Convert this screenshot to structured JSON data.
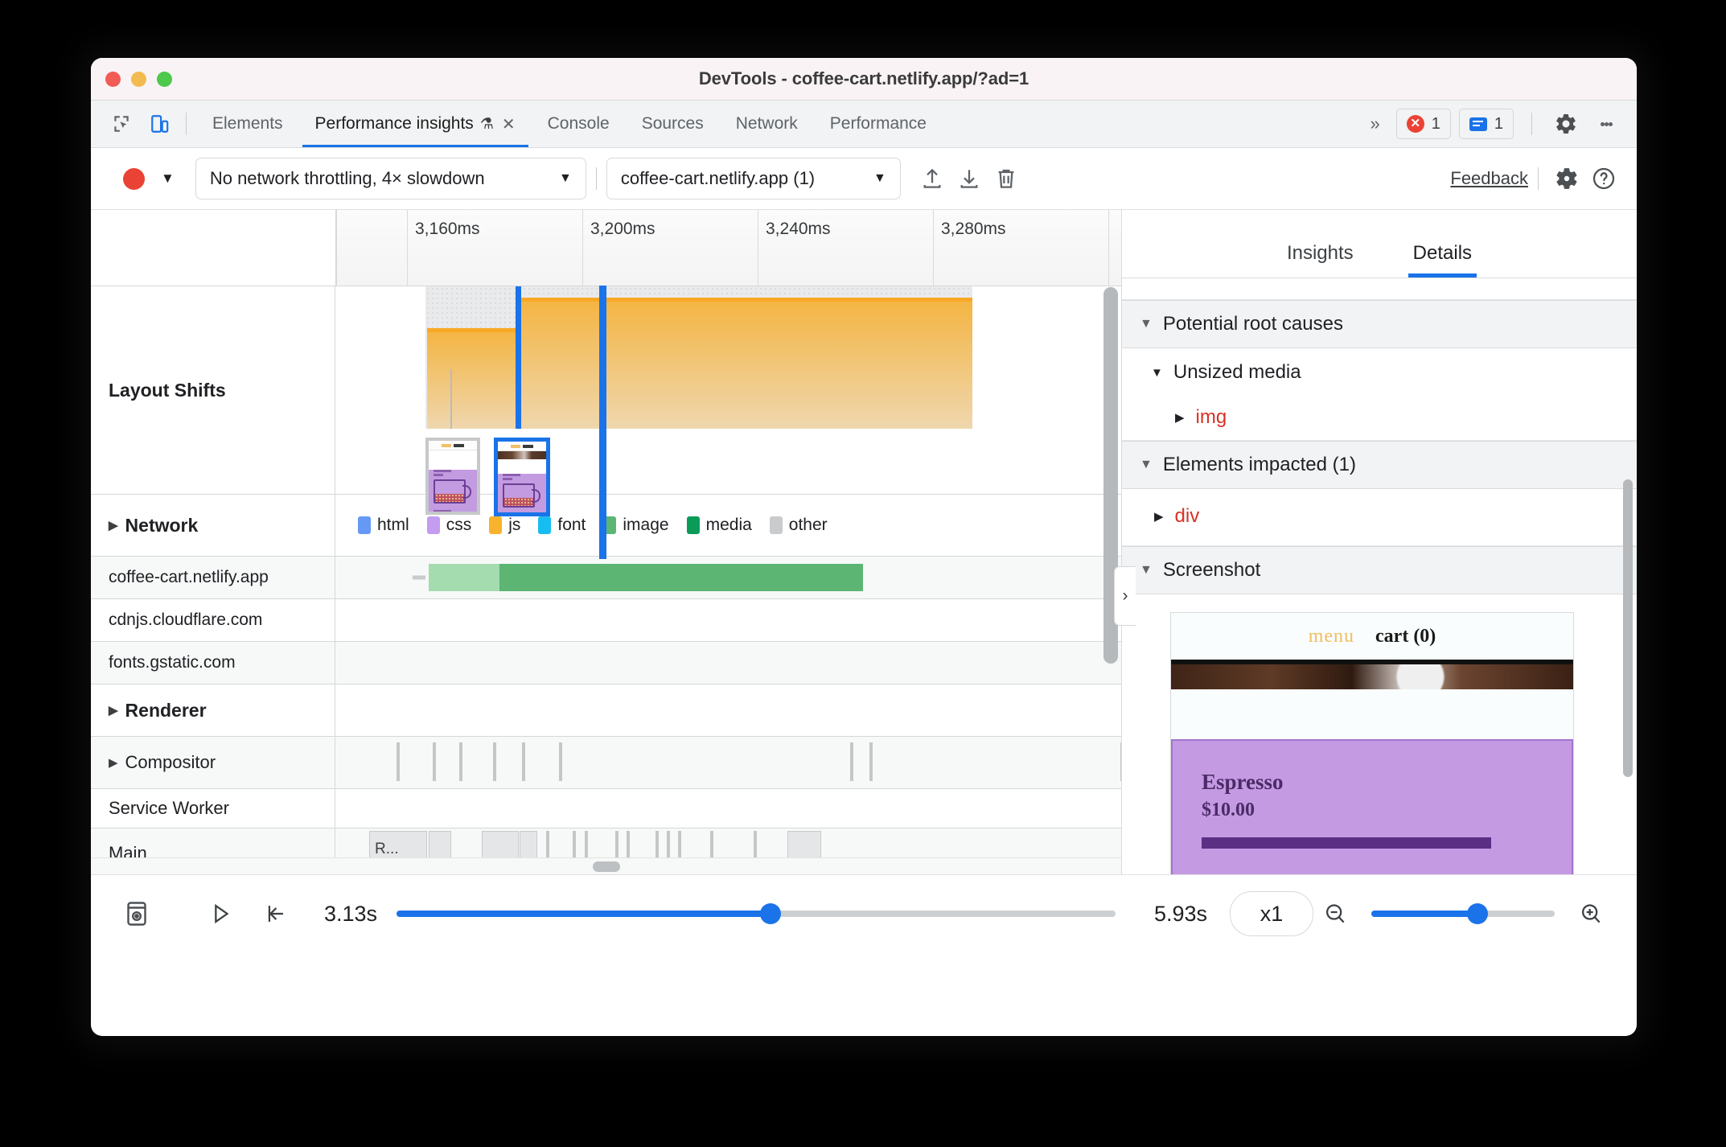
{
  "window": {
    "title": "DevTools - coffee-cart.netlify.app/?ad=1",
    "traffic_lights": [
      "close",
      "minimize",
      "zoom"
    ]
  },
  "tabstrip": {
    "left_icons": [
      "inspect-element-icon",
      "device-toolbar-icon"
    ],
    "tabs": [
      {
        "label": "Elements",
        "active": false
      },
      {
        "label": "Performance insights",
        "active": true,
        "flask": "⚗",
        "close": "✕"
      },
      {
        "label": "Console",
        "active": false
      },
      {
        "label": "Sources",
        "active": false
      },
      {
        "label": "Network",
        "active": false
      },
      {
        "label": "Performance",
        "active": false
      }
    ],
    "more_tabs": "»",
    "error_badge": "1",
    "message_badge": "1",
    "settings_icon": "gear-icon",
    "menu_icon": "kebab-menu-icon"
  },
  "toolbar": {
    "record_label": "record-button",
    "record_dropdown": "▼",
    "throttling": {
      "value": "No network throttling, 4× slowdown",
      "caret": "▼"
    },
    "origin": {
      "value": "coffee-cart.netlify.app (1)",
      "caret": "▼"
    },
    "upload_icon": "upload-icon",
    "download_icon": "download-icon",
    "delete_icon": "trash-icon",
    "feedback_label": "Feedback",
    "settings_icon": "settings-gear-icon",
    "help_icon": "help-icon"
  },
  "timeline": {
    "ruler_ticks": [
      "3,160ms",
      "3,200ms",
      "3,240ms",
      "3,280ms"
    ],
    "tracks": [
      {
        "name": "Layout Shifts",
        "bold": true,
        "expandable": false
      },
      {
        "name": "Network",
        "bold": true,
        "expandable": true,
        "arrow": "▶"
      },
      {
        "name": "coffee-cart.netlify.app",
        "bold": false,
        "expandable": false
      },
      {
        "name": "cdnjs.cloudflare.com",
        "bold": false,
        "expandable": false
      },
      {
        "name": "fonts.gstatic.com",
        "bold": false,
        "expandable": false
      },
      {
        "name": "Renderer",
        "bold": true,
        "expandable": true,
        "arrow": "▶"
      },
      {
        "name": "Compositor",
        "bold": false,
        "expandable": true,
        "arrow": "▶"
      },
      {
        "name": "Service Worker",
        "bold": false,
        "expandable": false
      },
      {
        "name": "Main",
        "bold": false,
        "expandable": false
      }
    ],
    "network_legend": [
      {
        "label": "html",
        "color": "#6699f5"
      },
      {
        "label": "css",
        "color": "#c49cf0"
      },
      {
        "label": "js",
        "color": "#f7b32c"
      },
      {
        "label": "font",
        "color": "#16bdf0"
      },
      {
        "label": "image",
        "color": "#5cb573"
      },
      {
        "label": "media",
        "color": "#0a9b59"
      },
      {
        "label": "other",
        "color": "#c9cbcd"
      }
    ],
    "main_event_label": "R...",
    "sidebar_toggle": "›"
  },
  "details": {
    "tabs": [
      {
        "label": "Insights",
        "active": false
      },
      {
        "label": "Details",
        "active": true
      }
    ],
    "sections": [
      {
        "title": "Potential root causes",
        "caret": "▼"
      },
      {
        "title": "Elements impacted (1)",
        "caret": "▼"
      },
      {
        "title": "Screenshot",
        "caret": "▼"
      }
    ],
    "root_cause_group": {
      "caret": "▼",
      "label": "Unsized media"
    },
    "root_cause_node": {
      "caret": "▶",
      "tag": "img"
    },
    "impacted_node": {
      "caret": "▶",
      "tag": "div"
    },
    "screenshot_preview": {
      "menu_label": "menu",
      "cart_label": "cart (0)",
      "product_name": "Espresso",
      "product_price": "$10.00"
    }
  },
  "bottombar": {
    "filmstrip_icon": "screenshot-toggle-icon",
    "play_icon": "▷",
    "jump_start_icon": "jump-to-start-icon",
    "time_start": "3.13s",
    "time_end": "5.93s",
    "speed": "x1",
    "zoom_out_icon": "zoom-out-icon",
    "zoom_in_icon": "zoom-in-icon",
    "breadcrumb_percent": 52,
    "zoom_percent": 58
  },
  "colors": {
    "accent": "#1a73e8",
    "error": "#ea4335",
    "tag": "#d93025",
    "shift_band": "#f4b544",
    "shift_top": "#f9a825"
  }
}
